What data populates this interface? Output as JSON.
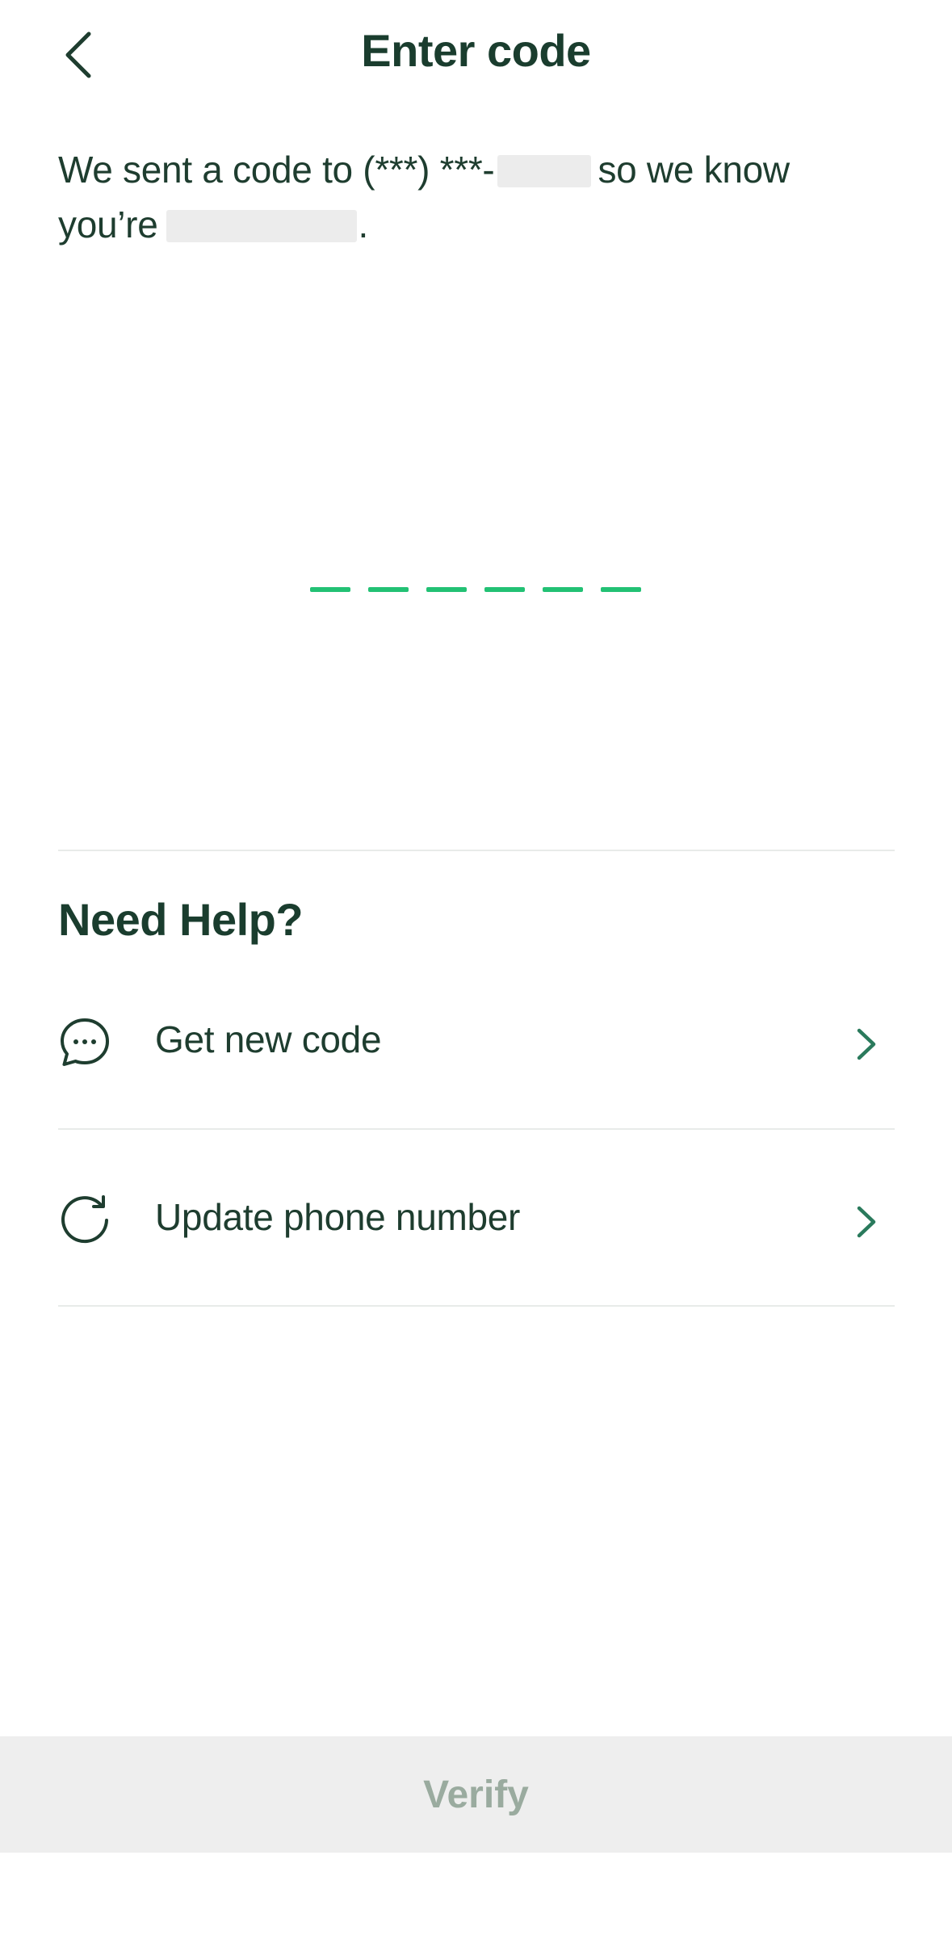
{
  "header": {
    "title": "Enter code",
    "back_icon": "chevron-left-icon"
  },
  "message": {
    "before_phone": "We sent a code to (***) ***-",
    "between": "so we know you’re",
    "after_name": "."
  },
  "code_input": {
    "length": 6,
    "value": ""
  },
  "help": {
    "title": "Need Help?",
    "items": [
      {
        "label": "Get new code",
        "icon": "chat-bubble-icon"
      },
      {
        "label": "Update phone number",
        "icon": "refresh-icon"
      }
    ]
  },
  "footer": {
    "verify_label": "Verify",
    "enabled": false
  },
  "colors": {
    "primary_text": "#1a3d2e",
    "accent_green": "#22c174",
    "chevron_green": "#2a7a5c",
    "disabled_text": "#9aab9f",
    "disabled_bg": "#eeeeee"
  }
}
